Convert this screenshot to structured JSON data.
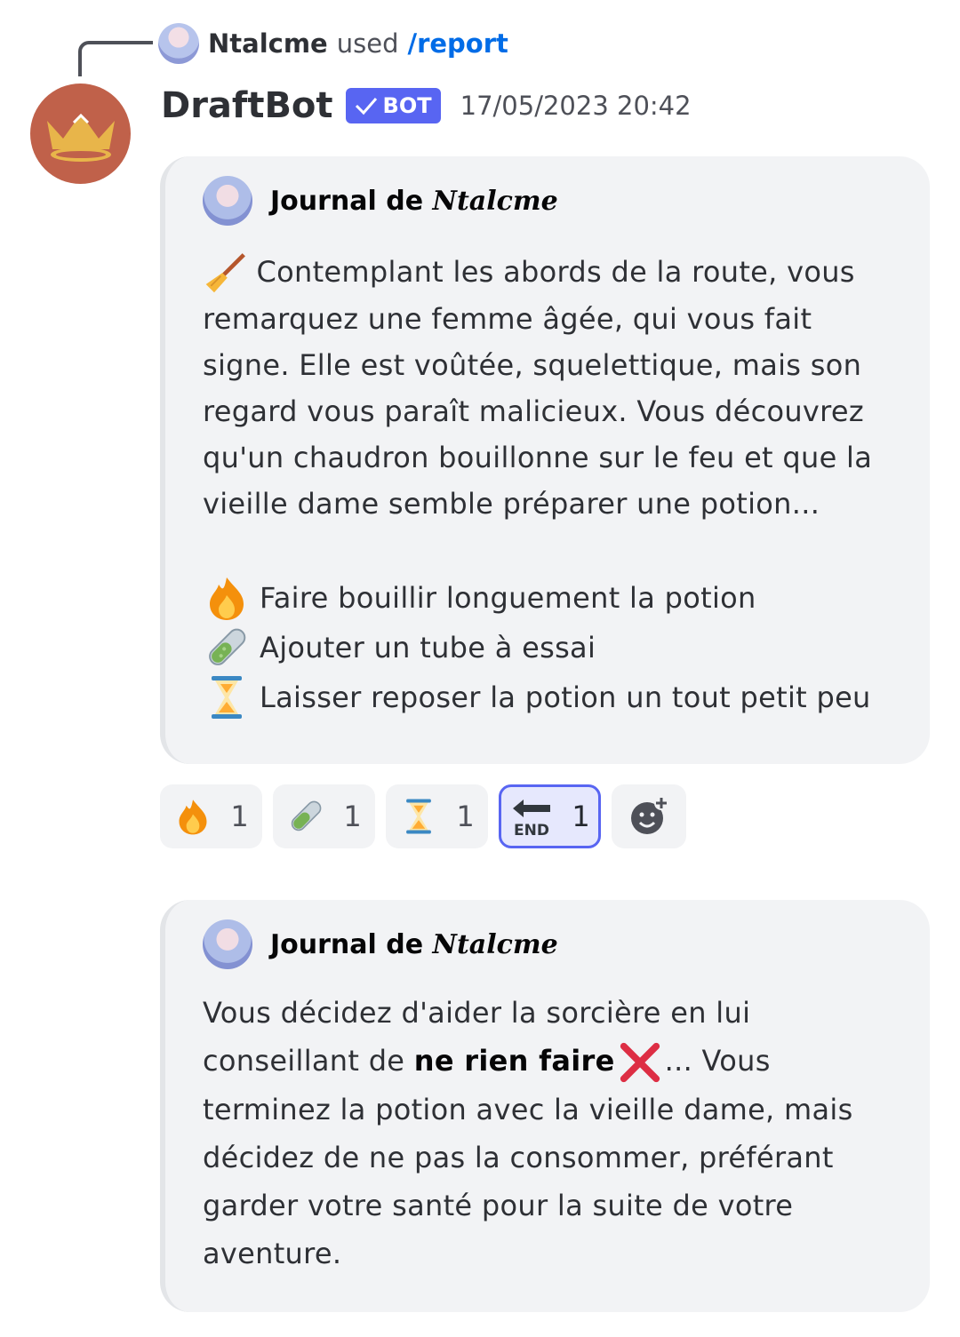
{
  "reply": {
    "user": "Ntalcme",
    "verb": "used",
    "command": "/report"
  },
  "message": {
    "author": "DraftBot",
    "badge": "BOT",
    "timestamp": "17/05/2023 20:42",
    "avatar_color": "#c0614a"
  },
  "embed1": {
    "author_prefix": "Journal de",
    "author_name": "Ntalcme",
    "intro_icon": "broom-icon",
    "intro": "Contemplant les abords de la route, vous remarquez une femme âgée, qui vous fait signe. Elle est voûtée, squelettique, mais son regard vous paraît malicieux. Vous découvrez qu'un chaudron bouillonne sur le feu et que la vieille dame semble préparer une potion...",
    "options": [
      {
        "icon": "fire-icon",
        "text": "Faire bouillir longuement la potion"
      },
      {
        "icon": "test-tube-icon",
        "text": "Ajouter un tube à essai"
      },
      {
        "icon": "hourglass-icon",
        "text": "Laisser reposer la potion un tout petit peu"
      }
    ]
  },
  "reactions": [
    {
      "icon": "fire-icon",
      "count": "1",
      "active": false
    },
    {
      "icon": "test-tube-icon",
      "count": "1",
      "active": false
    },
    {
      "icon": "hourglass-icon",
      "count": "1",
      "active": false
    },
    {
      "icon": "end-arrow-icon",
      "count": "1",
      "active": true
    },
    {
      "icon": "add-reaction-icon",
      "count": "",
      "active": false
    }
  ],
  "embed2": {
    "author_prefix": "Journal de",
    "author_name": "Ntalcme",
    "text_before": "Vous décidez d'aider la sorcière en lui conseillant de ",
    "text_bold": "ne rien faire",
    "cross_icon": "cross-mark-icon",
    "text_after": "... Vous terminez la potion avec la vieille dame, mais décidez de ne pas la consommer, préférant garder votre santé pour la suite de votre aventure."
  },
  "colors": {
    "accent": "#5865f2",
    "link": "#006ce7",
    "embed_bg": "#f2f3f5"
  }
}
